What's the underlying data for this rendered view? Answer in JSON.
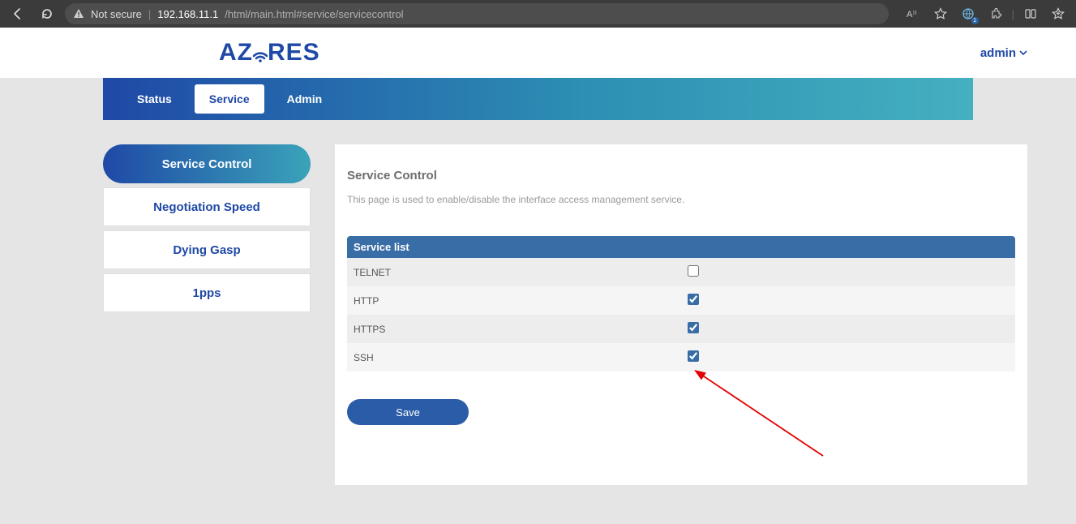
{
  "browser": {
    "security_label": "Not secure",
    "url_host": "192.168.11.1",
    "url_path": "/html/main.html#service/servicecontrol",
    "badge_count": "1"
  },
  "header": {
    "logo_text_left": "AZ",
    "logo_text_right": "RES",
    "user_label": "admin"
  },
  "nav": {
    "items": [
      {
        "label": "Status",
        "active": false
      },
      {
        "label": "Service",
        "active": true
      },
      {
        "label": "Admin",
        "active": false
      }
    ]
  },
  "sidebar": {
    "items": [
      {
        "label": "Service Control",
        "active": true
      },
      {
        "label": "Negotiation Speed",
        "active": false
      },
      {
        "label": "Dying Gasp",
        "active": false
      },
      {
        "label": "1pps",
        "active": false
      }
    ]
  },
  "main": {
    "title": "Service Control",
    "description": "This page is used to enable/disable the interface access management service.",
    "table_header": "Service list",
    "services": [
      {
        "name": "TELNET",
        "enabled": false
      },
      {
        "name": "HTTP",
        "enabled": true
      },
      {
        "name": "HTTPS",
        "enabled": true
      },
      {
        "name": "SSH",
        "enabled": true
      }
    ],
    "save_label": "Save"
  }
}
